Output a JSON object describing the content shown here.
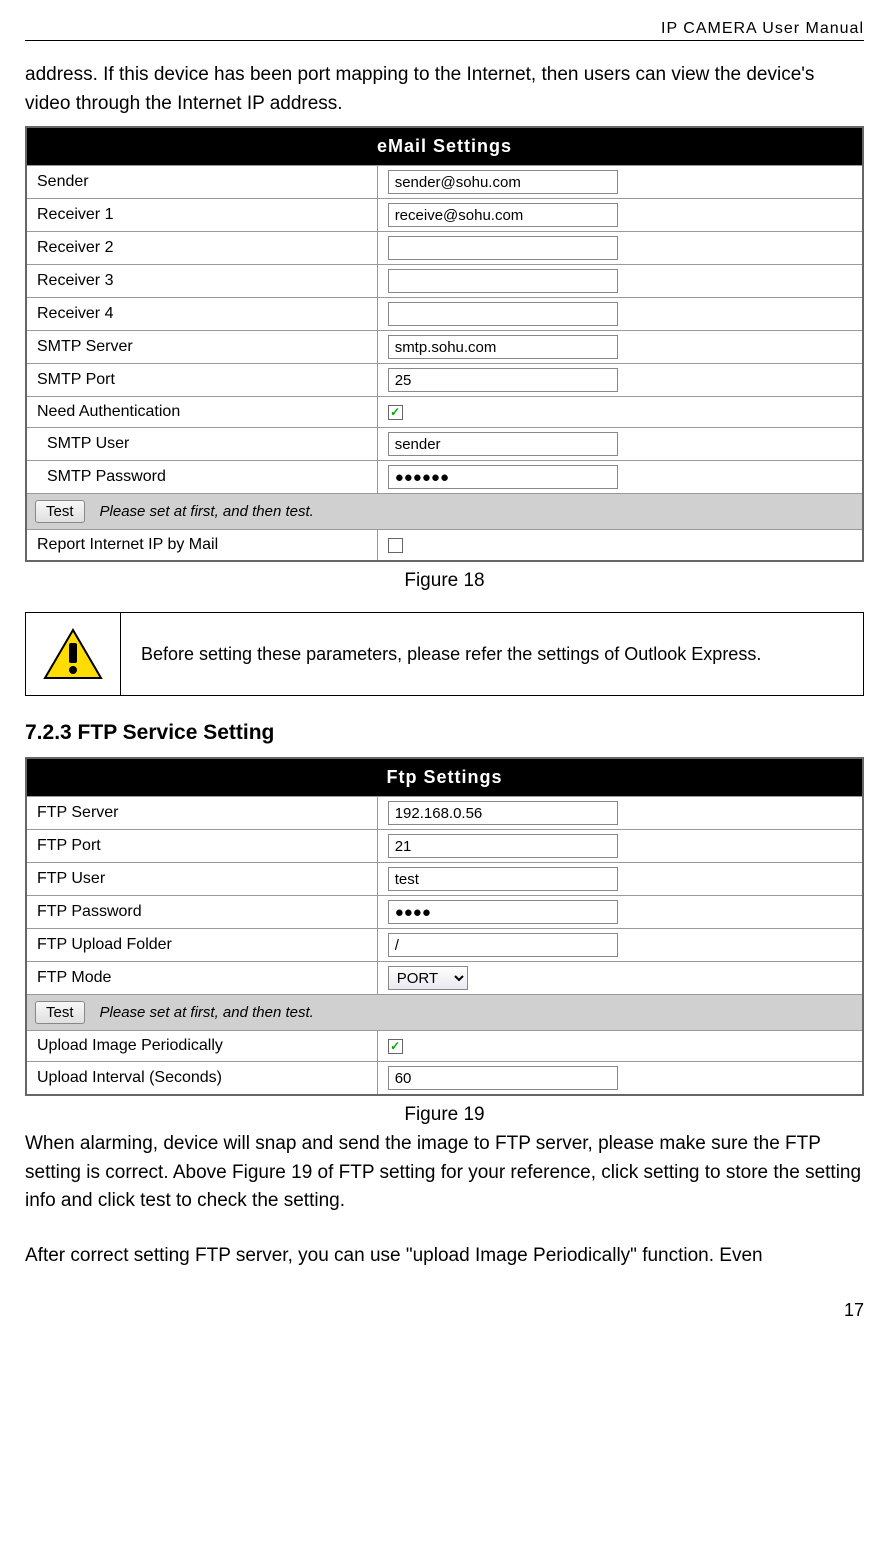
{
  "header_title": "IP CAMERA User Manual",
  "intro_text": "address. If this device has been port mapping to the Internet, then users can view the device's video through the Internet IP address.",
  "email_table": {
    "title": "eMail Settings",
    "rows": [
      {
        "label": "Sender",
        "value": "sender@sohu.com",
        "type": "text"
      },
      {
        "label": "Receiver 1",
        "value": "receive@sohu.com",
        "type": "text"
      },
      {
        "label": "Receiver 2",
        "value": "",
        "type": "text"
      },
      {
        "label": "Receiver 3",
        "value": "",
        "type": "text"
      },
      {
        "label": "Receiver 4",
        "value": "",
        "type": "text"
      },
      {
        "label": "SMTP Server",
        "value": "smtp.sohu.com",
        "type": "text"
      },
      {
        "label": "SMTP Port",
        "value": "25",
        "type": "text"
      },
      {
        "label": "Need Authentication",
        "checked": true,
        "type": "checkbox"
      },
      {
        "label": "SMTP User",
        "value": "sender",
        "type": "text",
        "indent": true
      },
      {
        "label": "SMTP Password",
        "value": "●●●●●●",
        "type": "text",
        "indent": true
      }
    ],
    "test_label": "Test",
    "test_note": "Please set at first, and then test.",
    "last_row": {
      "label": "Report Internet IP by Mail",
      "checked": false
    }
  },
  "figure18_caption": "Figure 18",
  "warning_text": "Before setting these parameters, please refer the settings of Outlook Express.",
  "section_heading": "7.2.3   FTP Service Setting",
  "ftp_table": {
    "title": "Ftp Settings",
    "rows": [
      {
        "label": "FTP Server",
        "value": "192.168.0.56",
        "type": "text"
      },
      {
        "label": "FTP Port",
        "value": "21",
        "type": "text"
      },
      {
        "label": "FTP User",
        "value": "test",
        "type": "text"
      },
      {
        "label": "FTP Password",
        "value": "●●●●",
        "type": "text"
      },
      {
        "label": "FTP Upload Folder",
        "value": "/",
        "type": "text"
      },
      {
        "label": "FTP Mode",
        "value": "PORT",
        "type": "select"
      }
    ],
    "test_label": "Test",
    "test_note": "Please set at first, and then test.",
    "bottom_rows": [
      {
        "label": "Upload Image Periodically",
        "checked": true,
        "type": "checkbox"
      },
      {
        "label": "Upload Interval (Seconds)",
        "value": "60",
        "type": "text"
      }
    ]
  },
  "figure19_caption": "Figure 19",
  "ftp_text1": "When alarming, device will snap and send the image to FTP server, please make sure the FTP setting is correct. Above Figure 19 of FTP setting for your reference, click setting to store the setting info and click test to check the setting.",
  "ftp_text2": "After correct setting FTP server, you can use \"upload Image Periodically\" function. Even",
  "page_number": "17"
}
